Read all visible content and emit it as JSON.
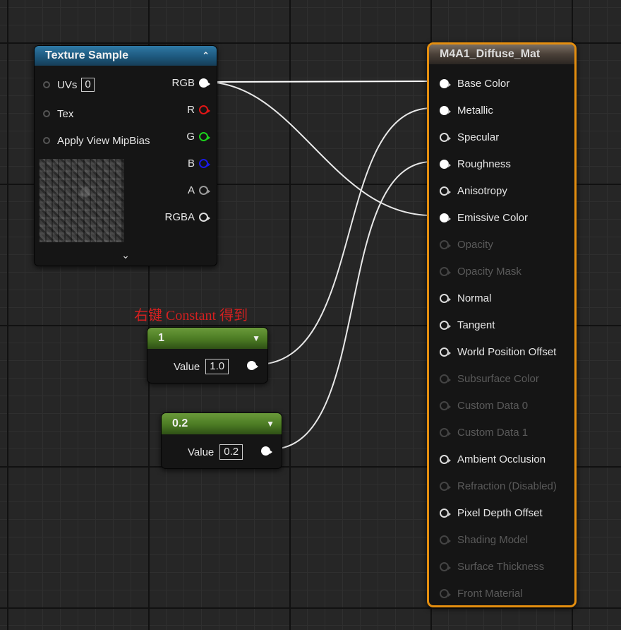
{
  "texture_node": {
    "title": "Texture Sample",
    "collapse_icon": "chevron-up",
    "inputs": [
      {
        "label": "UVs",
        "value": "0"
      },
      {
        "label": "Tex"
      },
      {
        "label": "Apply View MipBias"
      }
    ],
    "outputs": [
      {
        "label": "RGB",
        "color": "#ffffff",
        "style": "filled"
      },
      {
        "label": "R",
        "color": "#e01616",
        "style": "hollow"
      },
      {
        "label": "G",
        "color": "#1cd11c",
        "style": "hollow"
      },
      {
        "label": "B",
        "color": "#1a1ae8",
        "style": "hollow"
      },
      {
        "label": "A",
        "color": "#9a9a9a",
        "style": "hollow"
      },
      {
        "label": "RGBA",
        "color": "#dddddd",
        "style": "hollow"
      }
    ],
    "expand_icon": "chevron-down"
  },
  "annotation": "右键 Constant 得到",
  "constant_nodes": [
    {
      "title": "1",
      "value_label": "Value",
      "value": "1.0"
    },
    {
      "title": "0.2",
      "value_label": "Value",
      "value": "0.2"
    }
  ],
  "material_node": {
    "title": "M4A1_Diffuse_Mat",
    "inputs": [
      {
        "label": "Base Color",
        "state": "connected"
      },
      {
        "label": "Metallic",
        "state": "connected"
      },
      {
        "label": "Specular",
        "state": "open"
      },
      {
        "label": "Roughness",
        "state": "connected"
      },
      {
        "label": "Anisotropy",
        "state": "open"
      },
      {
        "label": "Emissive Color",
        "state": "connected"
      },
      {
        "label": "Opacity",
        "state": "disabled"
      },
      {
        "label": "Opacity Mask",
        "state": "disabled"
      },
      {
        "label": "Normal",
        "state": "open"
      },
      {
        "label": "Tangent",
        "state": "open"
      },
      {
        "label": "World Position Offset",
        "state": "open"
      },
      {
        "label": "Subsurface Color",
        "state": "disabled"
      },
      {
        "label": "Custom Data 0",
        "state": "disabled"
      },
      {
        "label": "Custom Data 1",
        "state": "disabled"
      },
      {
        "label": "Ambient Occlusion",
        "state": "open"
      },
      {
        "label": "Refraction (Disabled)",
        "state": "disabled"
      },
      {
        "label": "Pixel Depth Offset",
        "state": "open"
      },
      {
        "label": "Shading Model",
        "state": "disabled"
      },
      {
        "label": "Surface Thickness",
        "state": "disabled"
      },
      {
        "label": "Front Material",
        "state": "disabled"
      }
    ]
  },
  "colors": {
    "selection_outline": "#e48e0f",
    "texture_header": "#2f79a5",
    "constant_header": "#5c8c2e",
    "annotation": "#d32020"
  }
}
